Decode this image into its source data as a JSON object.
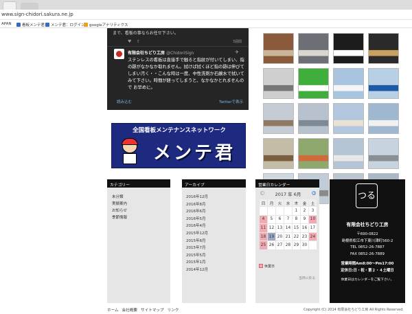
{
  "browser": {
    "url": "www.sign-chidori.sakura.ne.jp",
    "bookmarks": [
      {
        "label": "APAN",
        "color": "#ffffff"
      },
      {
        "label": "看板メンテ君",
        "color": "#3a66c4"
      },
      {
        "label": "メンテ君：ログイン",
        "color": "#3a66c4"
      },
      {
        "label": "googleアナリティクス",
        "color": "#e8a21a"
      }
    ]
  },
  "twitter": {
    "top_text": "まで、看板の事ならお任せ下さい。",
    "top_time": "3週間",
    "author": "有限会社ちどり工房",
    "handle": "@ChidoriSign",
    "tweet": "ステンレスの看板は直接手で触ると指紋が付いてしまい、指の跡がなかなか取れません。拭けば拭くほど指の跡は伸びてしまい汚く・・こんな時は一度、中性洗剤か石鹸水で拭いてみて下さい。時間が経ってしまうと、なかなかとれませんので お早めに。",
    "load_more": "読み込む",
    "view_on": "Twitterで表示"
  },
  "banner": {
    "top": "全国看板メンテナンスネットワーク",
    "logo": "メンテ君"
  },
  "photos": [
    {
      "bg": "#8a5a3a",
      "fg": "#c9b59a"
    },
    {
      "bg": "#6c6f76",
      "fg": "#d9d6cf"
    },
    {
      "bg": "#1c1c1c",
      "fg": "#ffffff"
    },
    {
      "bg": "#2a2a2a",
      "fg": "#c8a060"
    },
    {
      "bg": "#cfcfcf",
      "fg": "#777777"
    },
    {
      "bg": "#3fae3a",
      "fg": "#ffffff"
    },
    {
      "bg": "#a8c4de",
      "fg": "#f5f5f5"
    },
    {
      "bg": "#b7d0e6",
      "fg": "#1c5aa7"
    },
    {
      "bg": "#c5ccd6",
      "fg": "#8f7a63"
    },
    {
      "bg": "#b8c2cf",
      "fg": "#7d8a94"
    },
    {
      "bg": "#b2c6dd",
      "fg": "#e9e2d3"
    },
    {
      "bg": "#9fb7cf",
      "fg": "#f1f1f1"
    },
    {
      "bg": "#c4bca6",
      "fg": "#7b6040"
    },
    {
      "bg": "#8ea86e",
      "fg": "#cf6c3c"
    },
    {
      "bg": "#b6c5d6",
      "fg": "#e8e8e8"
    },
    {
      "bg": "#c7d3df",
      "fg": "#8a8f96"
    },
    {
      "bg": "#ced8e0",
      "fg": "#3c4d5a"
    },
    {
      "bg": "#c0ccd8",
      "fg": "#8a8a8a"
    },
    {
      "bg": "#bcc7d2",
      "fg": "#eeeeee"
    },
    {
      "bg": "#a9b7c6",
      "fg": "#d9d9d9"
    }
  ],
  "categories": {
    "heading": "カテゴリー",
    "items": [
      "未分類",
      "実績案内",
      "お知らせ",
      "季節情報"
    ]
  },
  "archive": {
    "heading": "アーカイブ",
    "items": [
      "2016年12月",
      "2016年8月",
      "2016年6月",
      "2016年5月",
      "2016年4月",
      "2015年12月",
      "2015年8月",
      "2015年7月",
      "2015年5月",
      "2015年1月",
      "2014年12月"
    ]
  },
  "calendar": {
    "heading": "営業日カレンダー",
    "month": "2017 年  6月",
    "weekdays": [
      "日",
      "月",
      "火",
      "水",
      "木",
      "金",
      "土"
    ],
    "weeks": [
      [
        "",
        "",
        "",
        "",
        "1",
        "2",
        "3"
      ],
      [
        "4",
        "5",
        "6",
        "7",
        "8",
        "9",
        "10"
      ],
      [
        "11",
        "12",
        "13",
        "14",
        "15",
        "16",
        "17"
      ],
      [
        "18",
        "19",
        "20",
        "21",
        "22",
        "23",
        "24"
      ],
      [
        "25",
        "26",
        "27",
        "28",
        "29",
        "30",
        ""
      ]
    ],
    "holidays": [
      "4",
      "10",
      "11",
      "18",
      "24",
      "25"
    ],
    "today": "19",
    "legend": "休業日",
    "prev_link": "当月に戻る"
  },
  "shop": {
    "logo": "つる",
    "name": "有限会社ちどり工房",
    "zip": "〒690-0822",
    "address": "島根県松江市下東川津町560-2",
    "tel": "TEL 0852-26-7887",
    "fax": "FAX 0852-26-7889",
    "hours": "営業時間Am8:00〜Pm17:00",
    "closed": "定休日:日・祝・第２・４土曜日",
    "note": "休業日はカレンダーをご覧下さい。"
  },
  "footer": {
    "nav": [
      "ホーム",
      "会社概要",
      "サイトマップ",
      "リンク"
    ],
    "copyright": "Copyright (C) 2014 有限会社ちどり工房   All Rights Reserved."
  }
}
